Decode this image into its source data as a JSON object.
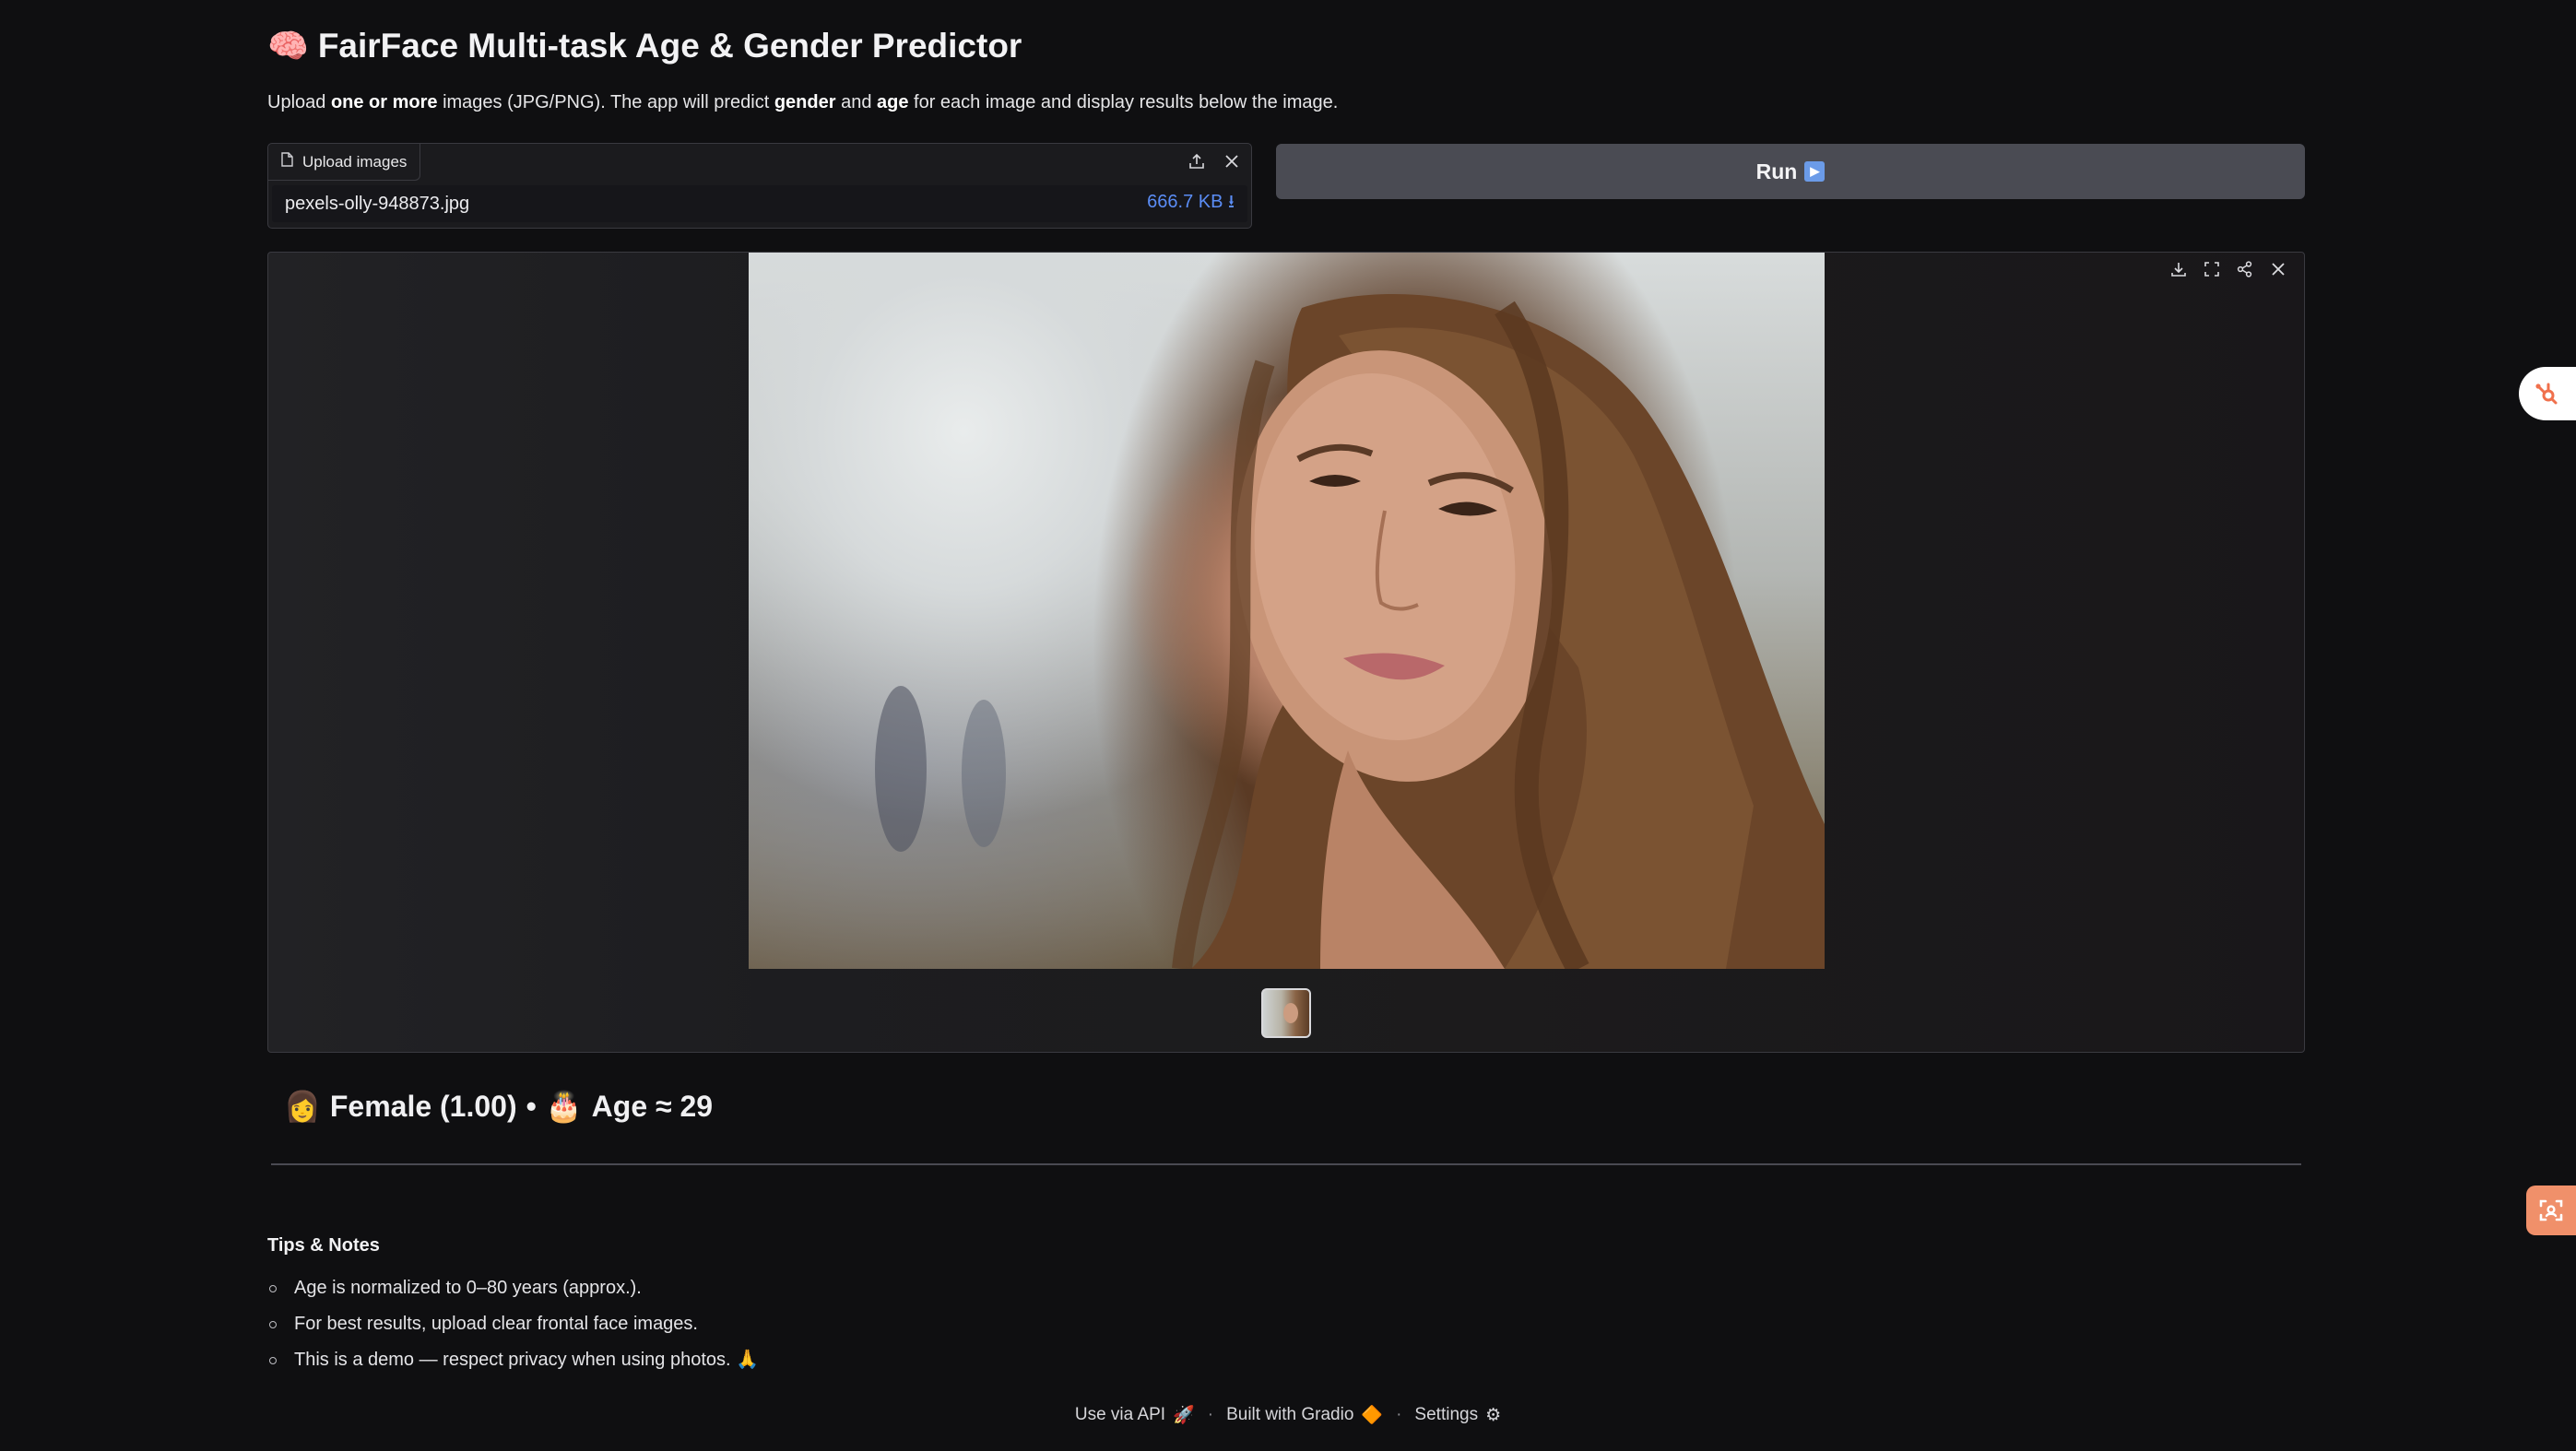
{
  "header": {
    "icon": "brain-emoji",
    "emoji": "🧠",
    "title": "FairFace Multi-task Age & Gender Predictor"
  },
  "description": {
    "p1": "Upload ",
    "b1": "one or more",
    "p2": " images (JPG/PNG). The app will predict ",
    "b2": "gender",
    "p3": " and ",
    "b3": "age",
    "p4": " for each image and display results below the image."
  },
  "upload": {
    "label": "Upload images",
    "file_name": "pexels-olly-948873.jpg",
    "file_size": "666.7 KB ⭳"
  },
  "run_button": {
    "label": "Run",
    "emoji": "▶"
  },
  "result": {
    "gender_emoji": "👩",
    "gender_text": "Female (1.00)",
    "separator": "•",
    "age_emoji": "🎂",
    "age_text": "Age ≈ 29"
  },
  "tips": {
    "title": "Tips & Notes",
    "items": [
      "Age is normalized to 0–80 years (approx.).",
      "For best results, upload clear frontal face images.",
      "This is a demo — respect privacy when using photos. 🙏"
    ]
  },
  "footer": {
    "api": "Use via API",
    "api_emoji": "🚀",
    "built": "Built with Gradio",
    "built_emoji": "🔶",
    "settings": "Settings",
    "settings_emoji": "⚙",
    "dot": "·"
  },
  "colors": {
    "background": "#0f0f11",
    "accent_link": "#5b8df6",
    "run_button": "#4a4b53"
  }
}
